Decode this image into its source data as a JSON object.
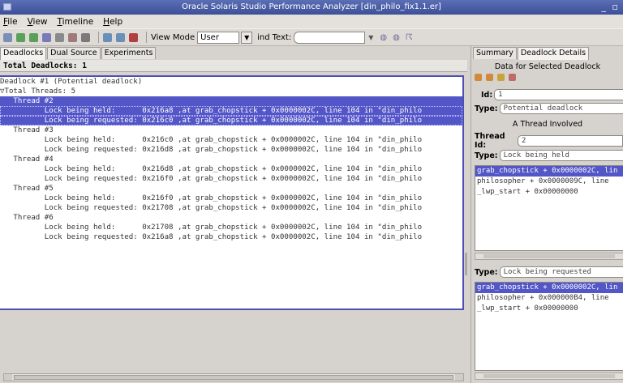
{
  "window": {
    "title": "Oracle Solaris Studio Performance Analyzer [din_philo_fix1.1.er]",
    "controls": "_ ▫"
  },
  "menu": [
    "File",
    "View",
    "Timeline",
    "Help"
  ],
  "toolbar": {
    "icons": [
      {
        "name": "open-experiment-icon",
        "color": "#7a8fb8"
      },
      {
        "name": "compare-icon",
        "color": "#5aa05a"
      },
      {
        "name": "collect-icon",
        "color": "#5aa05a"
      },
      {
        "name": "save-icon",
        "color": "#7a7ab8"
      },
      {
        "name": "print-icon",
        "color": "#8a8a8a"
      },
      {
        "name": "export-icon",
        "color": "#a07a7a"
      },
      {
        "name": "settings-icon",
        "color": "#7a7a7a"
      },
      {
        "name": "filter-icon",
        "color": "#6a8fb8"
      },
      {
        "name": "filter-funnel-icon",
        "color": "#6a8fb8"
      },
      {
        "name": "reset-icon",
        "color": "#b04040"
      }
    ],
    "view_mode_label": "View Mode",
    "view_mode_value": "User",
    "find_label": "ind",
    "text_label": "Text:"
  },
  "left": {
    "tabs": [
      "Deadlocks",
      "Dual Source",
      "Experiments"
    ],
    "total": "Total Deadlocks: 1",
    "rows": [
      {
        "text": "Deadlock #1 (Potential deadlock)",
        "indent": 0,
        "sel": false
      },
      {
        "text": "▽Total Threads: 5",
        "indent": 0,
        "sel": false
      },
      {
        "text": "   Thread #2",
        "indent": 1,
        "sel": true
      },
      {
        "text": "          Lock being held:      0x216a8 ,at grab_chopstick + 0x0000002C, line 104 in \"din_philo",
        "indent": 2,
        "sel": true
      },
      {
        "text": "          Lock being requested: 0x216c0 ,at grab_chopstick + 0x0000002C, line 104 in \"din_philo",
        "indent": 2,
        "sel": true
      },
      {
        "text": "   Thread #3",
        "indent": 1,
        "sel": false
      },
      {
        "text": "          Lock being held:      0x216c0 ,at grab_chopstick + 0x0000002C, line 104 in \"din_philo",
        "indent": 2,
        "sel": false
      },
      {
        "text": "          Lock being requested: 0x216d8 ,at grab_chopstick + 0x0000002C, line 104 in \"din_philo",
        "indent": 2,
        "sel": false
      },
      {
        "text": "   Thread #4",
        "indent": 1,
        "sel": false
      },
      {
        "text": "          Lock being held:      0x216d8 ,at grab_chopstick + 0x0000002C, line 104 in \"din_philo",
        "indent": 2,
        "sel": false
      },
      {
        "text": "          Lock being requested: 0x216f0 ,at grab_chopstick + 0x0000002C, line 104 in \"din_philo",
        "indent": 2,
        "sel": false
      },
      {
        "text": "   Thread #5",
        "indent": 1,
        "sel": false
      },
      {
        "text": "          Lock being held:      0x216f0 ,at grab_chopstick + 0x0000002C, line 104 in \"din_philo",
        "indent": 2,
        "sel": false
      },
      {
        "text": "          Lock being requested: 0x21708 ,at grab_chopstick + 0x0000002C, line 104 in \"din_philo",
        "indent": 2,
        "sel": false
      },
      {
        "text": "   Thread #6",
        "indent": 1,
        "sel": false
      },
      {
        "text": "          Lock being held:      0x21708 ,at grab_chopstick + 0x0000002C, line 104 in \"din_philo",
        "indent": 2,
        "sel": false
      },
      {
        "text": "          Lock being requested: 0x216a8 ,at grab_chopstick + 0x0000002C, line 104 in \"din_philo",
        "indent": 2,
        "sel": false
      }
    ]
  },
  "right": {
    "tabs": [
      "Summary",
      "Deadlock Details"
    ],
    "header": "Data for Selected Deadlock",
    "id_label": "Id:",
    "id_value": "1",
    "type_label": "Type:",
    "type_value": "Potential deadlock",
    "thread_section": "A Thread Involved",
    "thread_id_label": "Thread Id:",
    "thread_id_value": "2",
    "held_type_label": "Type:",
    "held_type_value": "Lock being held",
    "held_stack": [
      "grab_chopstick + 0x0000002C, lin",
      "philosopher + 0x0000009C, line ",
      "_lwp_start + 0x00000000"
    ],
    "req_type_label": "Type:",
    "req_type_value": "Lock being requested",
    "req_stack": [
      "grab_chopstick + 0x0000002C, lin",
      "philosopher + 0x000000B4, line ",
      "_lwp_start + 0x00000000"
    ]
  }
}
